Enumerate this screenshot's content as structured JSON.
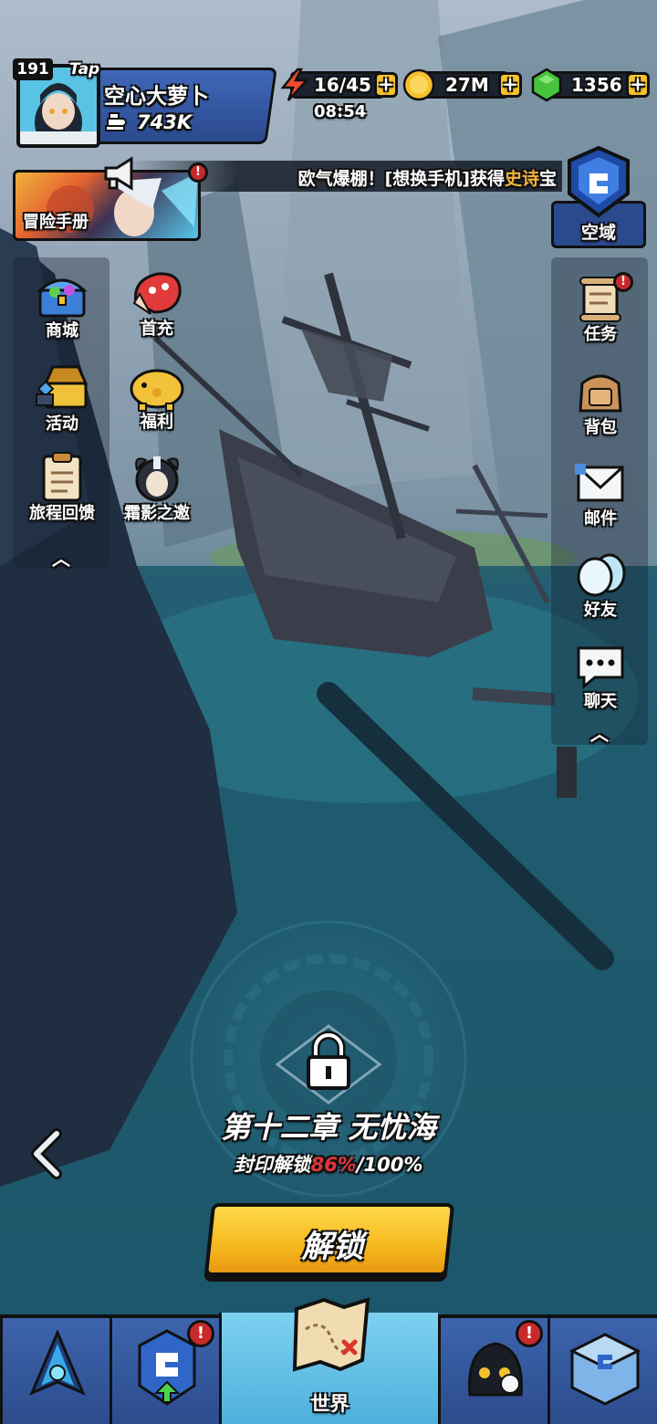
{
  "player": {
    "level": "191",
    "tag": "Tap",
    "name": "空心大萝卜",
    "power": "743K"
  },
  "resources": {
    "energy": "16/45",
    "energy_timer": "08:54",
    "gold": "27M",
    "gems": "1356",
    "plus": "+"
  },
  "marquee": {
    "prefix": "欧气爆棚！[想换手机]获得",
    "highlight": "史诗",
    "suffix": "宝"
  },
  "adventure_banner": {
    "label": "冒险手册"
  },
  "sky_domain": {
    "label": "空域"
  },
  "left_menu": [
    {
      "id": "shop",
      "label": "商城",
      "icon": "treasure-chest-icon"
    },
    {
      "id": "first-recharge",
      "label": "首充",
      "icon": "first-recharge-icon"
    },
    {
      "id": "events",
      "label": "活动",
      "icon": "event-chest-icon"
    },
    {
      "id": "welfare",
      "label": "福利",
      "icon": "piggy-bank-icon"
    },
    {
      "id": "journey-review",
      "label": "旅程回馈",
      "icon": "clipboard-icon"
    },
    {
      "id": "frost-shadow",
      "label": "霜影之邀",
      "icon": "frost-shadow-icon"
    }
  ],
  "right_menu": [
    {
      "id": "quests",
      "label": "任务",
      "icon": "scroll-icon"
    },
    {
      "id": "bag",
      "label": "背包",
      "icon": "bag-icon"
    },
    {
      "id": "mail",
      "label": "邮件",
      "icon": "mail-icon"
    },
    {
      "id": "friends",
      "label": "好友",
      "icon": "friends-icon"
    },
    {
      "id": "chat",
      "label": "聊天",
      "icon": "chat-icon"
    }
  ],
  "chapter": {
    "title": "第十二章 无忧海",
    "seal_prefix": "封印解锁",
    "seal_progress": "86%",
    "seal_total": "/100%",
    "progress_value": 0.86,
    "unlock_label": "解锁"
  },
  "bottom_nav": {
    "tabs": [
      {
        "id": "heroes",
        "label": "",
        "icon": "hero-crest-icon"
      },
      {
        "id": "upgrade",
        "label": "",
        "icon": "upgrade-card-icon"
      },
      {
        "id": "world",
        "label": "世界",
        "icon": "world-map-icon"
      },
      {
        "id": "guild",
        "label": "",
        "icon": "guild-creatures-icon"
      },
      {
        "id": "home",
        "label": "",
        "icon": "home-icon"
      }
    ]
  },
  "colors": {
    "sea": "#1e5a6e",
    "accent_yellow": "#f6b81f",
    "alert_red": "#c72a2a",
    "epic_text": "#f3b33a",
    "progress_red": "#e0343a",
    "panel_blue": "#2c4c8d"
  }
}
